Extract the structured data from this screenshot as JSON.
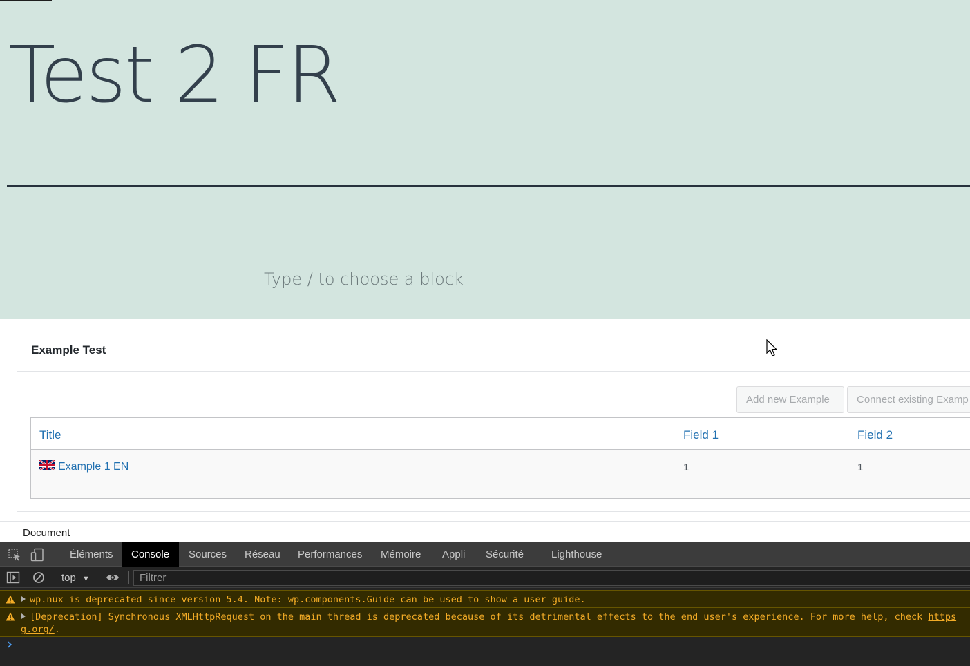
{
  "editor": {
    "title": "Test 2 FR",
    "placeholder": "Type / to choose a block"
  },
  "metabox": {
    "title": "Example Test",
    "add_button": "Add new Example",
    "connect_button": "Connect existing Examp",
    "columns": [
      "Title",
      "Field 1",
      "Field 2"
    ],
    "rows": [
      {
        "title": "Example 1 EN",
        "flag": "uk-flag-icon",
        "field1": "1",
        "field2": "1"
      }
    ]
  },
  "breadcrumb": "Document",
  "devtools": {
    "tabs": [
      "Éléments",
      "Console",
      "Sources",
      "Réseau",
      "Performances",
      "Mémoire",
      "Appli",
      "Sécurité",
      "Lighthouse"
    ],
    "active_tab": "Console",
    "context": "top",
    "filter_placeholder": "Filtrer",
    "messages": [
      {
        "level": "warning",
        "text": "wp.nux is deprecated since version 5.4. Note: wp.components.Guide can be used to show a user guide."
      },
      {
        "level": "warning",
        "text": "[Deprecation] Synchronous XMLHttpRequest on the main thread is deprecated because of its detrimental effects to the end user's experience. For more help, check ",
        "link": "https",
        "continuation_link": "g.org/",
        "continuation_tail": "."
      }
    ]
  },
  "colors": {
    "editor_background": "#d3e5df",
    "link_blue": "#2271b1",
    "warning_text": "#f2ab26",
    "devtools_bg": "#242424"
  }
}
